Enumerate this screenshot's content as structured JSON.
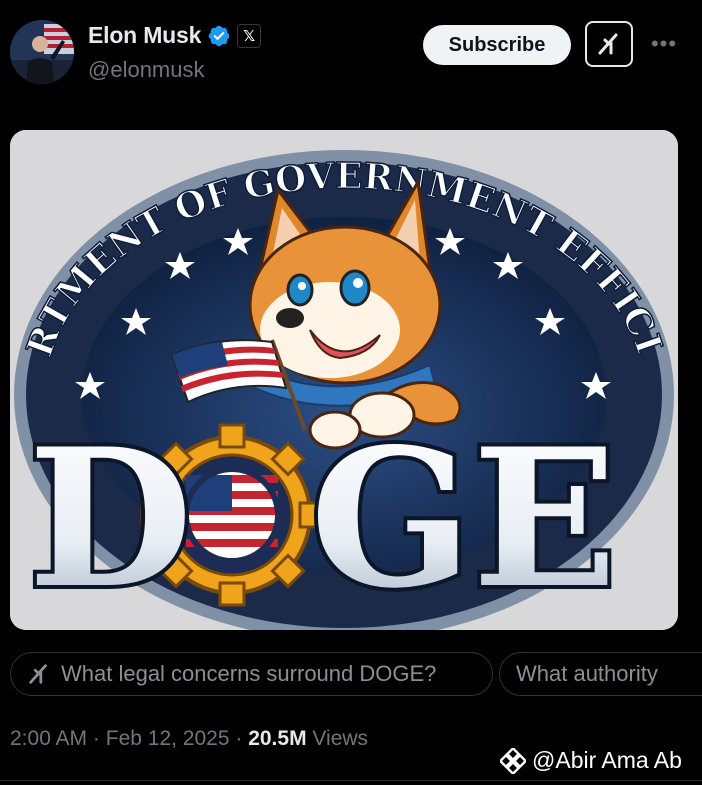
{
  "post": {
    "author_name": "Elon Musk",
    "author_handle": "@elonmusk",
    "subscribe_label": "Subscribe",
    "more_label": "•••",
    "x_badge": "𝕏",
    "time": "2:00 AM",
    "date": "Feb 12, 2025",
    "views_count": "20.5M",
    "views_label": "Views",
    "separator": "·"
  },
  "image": {
    "arc_text": "DEPARTMENT OF GOVERNMENT EFFICIENCY",
    "logo_text_d": "D",
    "logo_text_ge": "GE"
  },
  "chips": [
    {
      "label": "What legal concerns surround DOGE?"
    },
    {
      "label": "What authority"
    }
  ],
  "watermark": {
    "text": "@Abir Ama Ab"
  },
  "colors": {
    "background": "#000000",
    "verified": "#1d9bf0",
    "text_primary": "#e7e9ea",
    "text_secondary": "#71767b",
    "border": "#2f3336"
  },
  "icons": {
    "verified": "verified-badge-icon",
    "grok": "grok-icon",
    "more": "more-icon"
  }
}
